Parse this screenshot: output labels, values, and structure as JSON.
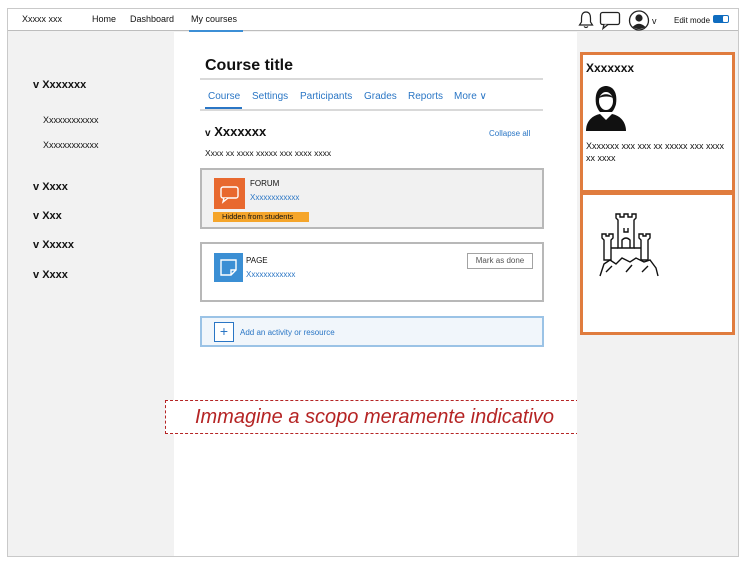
{
  "topbar": {
    "brand": "Xxxxx xxx",
    "nav": [
      "Home",
      "Dashboard",
      "My courses"
    ],
    "edit_mode_label": "Edit mode",
    "user_menu_caret": "v"
  },
  "icons": {
    "notifications": "bell-icon",
    "messages": "chat-icon",
    "user": "user-avatar-icon"
  },
  "course_index": {
    "sections": [
      {
        "label": "Xxxxxxx",
        "expanded": true,
        "items": [
          "Xxxxxxxxxxxx",
          "Xxxxxxxxxxxx"
        ]
      },
      {
        "label": "Xxxx"
      },
      {
        "label": "Xxx"
      },
      {
        "label": "Xxxxx"
      },
      {
        "label": "Xxxx"
      }
    ],
    "caret": "v"
  },
  "main": {
    "course_title": "Course title",
    "tabs": [
      "Course",
      "Settings",
      "Participants",
      "Grades",
      "Reports",
      "More ∨"
    ],
    "active_tab": "Course",
    "section": {
      "title": "Xxxxxxx",
      "caret": "v",
      "collapse_all": "Collapse all",
      "summary": "Xxxx xx xxxx xxxxx xxx xxxx xxxx"
    },
    "activities": [
      {
        "type": "FORUM",
        "name": "Xxxxxxxxxxxx",
        "badge": "Hidden from students",
        "icon_color": "#e8692f"
      },
      {
        "type": "PAGE",
        "name": "Xxxxxxxxxxxx",
        "action": "Mark as done",
        "icon_color": "#3b8fd4"
      }
    ],
    "add_activity": {
      "plus": "+",
      "label": "Add an activity or resource"
    }
  },
  "disclaimer": "Immagine a scopo meramente indicativo",
  "blocks": {
    "user": {
      "title": "Xxxxxxx",
      "text": "Xxxxxxx xxx xxx xx xxxxx xxx xxxx xx xxxx"
    },
    "castle_icon": "castle-icon"
  },
  "colors": {
    "accent_blue": "#2a76c5",
    "block_border": "#e07c3e",
    "badge": "#f5a52a",
    "disclaimer": "#b52424"
  }
}
